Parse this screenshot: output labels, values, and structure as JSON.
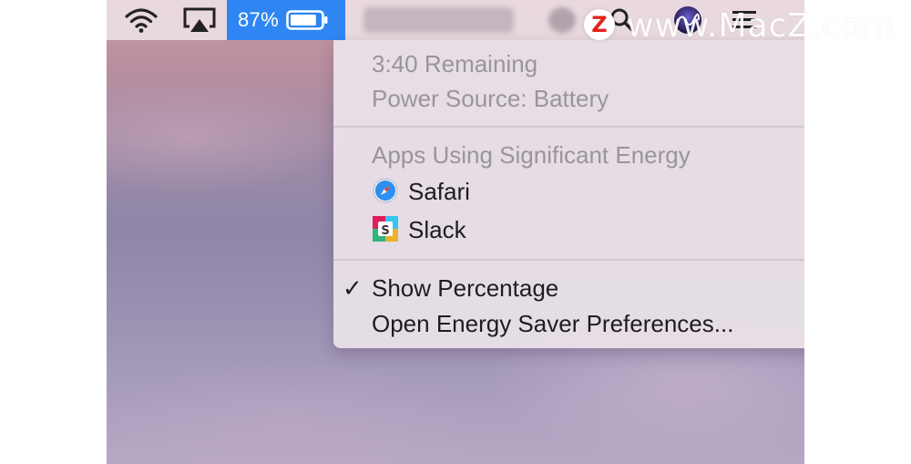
{
  "menubar": {
    "icons": [
      "wifi-icon",
      "airplay-icon",
      "search-icon",
      "siri-icon",
      "notification-list-icon"
    ],
    "battery_percent": "87%",
    "battery_level": 0.87,
    "accent": "#2f86f2"
  },
  "battery_menu": {
    "time_remaining": "3:40 Remaining",
    "power_source": "Power Source: Battery",
    "apps_header": "Apps Using Significant Energy",
    "apps": [
      {
        "name": "Safari",
        "icon": "safari-icon"
      },
      {
        "name": "Slack",
        "icon": "slack-icon"
      }
    ],
    "show_percentage": "Show Percentage",
    "show_percentage_checked": true,
    "open_prefs": "Open Energy Saver Preferences..."
  },
  "watermark": {
    "badge": "Z",
    "text": "www.MacZ.com"
  }
}
